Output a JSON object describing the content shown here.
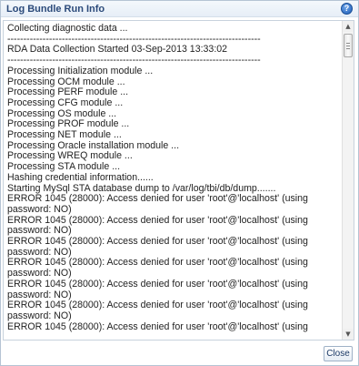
{
  "dialog": {
    "title": "Log Bundle Run Info",
    "help_icon": "help-icon",
    "help_glyph": "?",
    "close_label": "Close"
  },
  "log": {
    "lines": [
      "Collecting diagnostic data ...",
      "-------------------------------------------------------------------------------",
      "RDA Data Collection Started 03-Sep-2013 13:33:02",
      "-------------------------------------------------------------------------------",
      "Processing Initialization module ...",
      "Processing OCM module ...",
      "Processing PERF module ...",
      "Processing CFG module ...",
      "Processing OS module ...",
      "Processing PROF module ...",
      "Processing NET module ...",
      "Processing Oracle installation module ...",
      "Processing WREQ module ...",
      "Processing STA module ...",
      "Hashing credential information......",
      "Starting MySql STA database dump to /var/log/tbi/db/dump.......",
      "ERROR 1045 (28000): Access denied for user 'root'@'localhost' (using password: NO)",
      "ERROR 1045 (28000): Access denied for user 'root'@'localhost' (using password: NO)",
      "ERROR 1045 (28000): Access denied for user 'root'@'localhost' (using password: NO)",
      "ERROR 1045 (28000): Access denied for user 'root'@'localhost' (using password: NO)",
      "ERROR 1045 (28000): Access denied for user 'root'@'localhost' (using password: NO)",
      "ERROR 1045 (28000): Access denied for user 'root'@'localhost' (using password: NO)",
      "ERROR 1045 (28000): Access denied for user 'root'@'localhost' (using"
    ]
  },
  "scrollbar": {
    "up_icon": "scroll-up-arrow-icon",
    "down_icon": "scroll-down-arrow-icon"
  }
}
